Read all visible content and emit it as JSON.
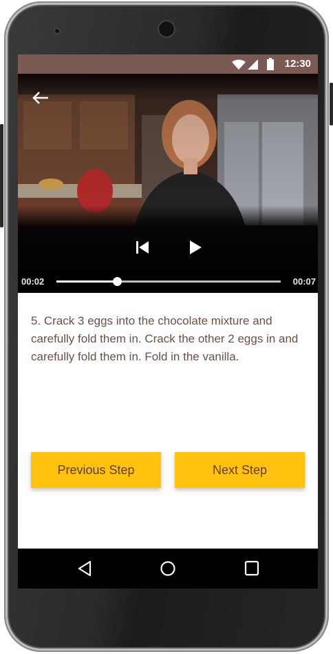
{
  "status_bar": {
    "time": "12:30"
  },
  "video": {
    "current_time": "00:02",
    "duration": "00:07",
    "progress": 0.27
  },
  "step": {
    "text": "5. Crack 3 eggs into the chocolate mixture and carefully fold them in. Crack the other 2 eggs in and carefully fold them in. Fold in the vanilla."
  },
  "buttons": {
    "previous": "Previous Step",
    "next": "Next Step"
  },
  "icons": {
    "back": "arrow-left-icon",
    "skip_previous": "skip-previous-icon",
    "play": "play-icon",
    "wifi": "wifi-icon",
    "signal": "signal-icon",
    "battery": "battery-icon",
    "nav_back": "triangle-back-icon",
    "nav_home": "circle-home-icon",
    "nav_recents": "square-recents-icon"
  },
  "colors": {
    "accent": "#ffc20e",
    "status_bar": "#7a5a52",
    "text": "#6b4f48"
  }
}
